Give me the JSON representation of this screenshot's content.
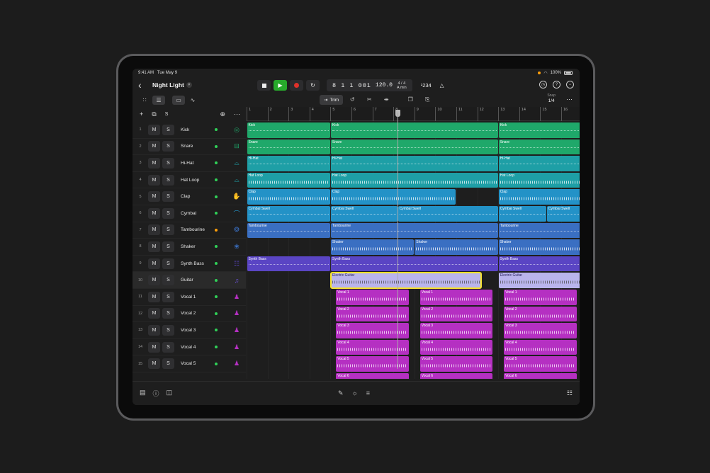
{
  "status": {
    "time": "9:41 AM",
    "date": "Tue May 9",
    "battery": "100%"
  },
  "project": {
    "title": "Night Light"
  },
  "transport": {
    "position": "8 1 1 001",
    "tempo": "120.0",
    "time_signature": "4 / 4",
    "key": "A min",
    "count_in": "¹234"
  },
  "toolbar": {
    "trim_label": "Trim",
    "snap_label": "Snap",
    "snap_value": "1/4"
  },
  "ruler": [
    "1",
    "2",
    "3",
    "4",
    "5",
    "6",
    "7",
    "8",
    "9",
    "10",
    "11",
    "12",
    "13",
    "14",
    "15",
    "16"
  ],
  "tracks": [
    {
      "num": "1",
      "name": "Kick",
      "icon": "kick-drum-icon",
      "color": "#1fa86a",
      "led": "green"
    },
    {
      "num": "2",
      "name": "Snare",
      "icon": "snare-drum-icon",
      "color": "#1fa86a",
      "led": "green"
    },
    {
      "num": "3",
      "name": "Hi-Hat",
      "icon": "hi-hat-icon",
      "color": "#1e9fa6",
      "led": "green"
    },
    {
      "num": "4",
      "name": "Hat Loop",
      "icon": "hi-hat-loop-icon",
      "color": "#1e9fa6",
      "led": "green"
    },
    {
      "num": "5",
      "name": "Clap",
      "icon": "clap-icon",
      "color": "#2392c7",
      "led": "green"
    },
    {
      "num": "6",
      "name": "Cymbal",
      "icon": "cymbal-icon",
      "color": "#2392c7",
      "led": "green"
    },
    {
      "num": "7",
      "name": "Tambourine",
      "icon": "tambourine-icon",
      "color": "#3a6fc2",
      "led": "orange"
    },
    {
      "num": "8",
      "name": "Shaker",
      "icon": "shaker-icon",
      "color": "#3a6fc2",
      "led": "green"
    },
    {
      "num": "9",
      "name": "Synth Bass",
      "icon": "keyboard-icon",
      "color": "#5a45c4",
      "led": "green"
    },
    {
      "num": "10",
      "name": "Guitar",
      "icon": "guitar-icon",
      "color": "#6a52d6",
      "led": "green"
    },
    {
      "num": "11",
      "name": "Vocal 1",
      "icon": "vocal-icon",
      "color": "#b530c2",
      "led": "green"
    },
    {
      "num": "12",
      "name": "Vocal 2",
      "icon": "vocal-icon",
      "color": "#b530c2",
      "led": "green"
    },
    {
      "num": "13",
      "name": "Vocal 3",
      "icon": "vocal-icon",
      "color": "#b530c2",
      "led": "green"
    },
    {
      "num": "14",
      "name": "Vocal 4",
      "icon": "vocal-icon",
      "color": "#b530c2",
      "led": "green"
    },
    {
      "num": "15",
      "name": "Vocal 5",
      "icon": "vocal-icon",
      "color": "#b530c2",
      "led": "green"
    }
  ],
  "mute_label": "M",
  "solo_label": "S",
  "regions": [
    {
      "lane": 0,
      "bar": 1,
      "len": 4,
      "label": "Kick",
      "kind": "midi"
    },
    {
      "lane": 0,
      "bar": 5,
      "len": 8,
      "label": "Kick",
      "kind": "midi"
    },
    {
      "lane": 0,
      "bar": 13,
      "len": 4,
      "label": "Kick",
      "kind": "midi"
    },
    {
      "lane": 1,
      "bar": 1,
      "len": 4,
      "label": "Snare",
      "kind": "midi"
    },
    {
      "lane": 1,
      "bar": 5,
      "len": 8,
      "label": "Snare",
      "kind": "midi"
    },
    {
      "lane": 1,
      "bar": 13,
      "len": 4,
      "label": "Snare",
      "kind": "midi"
    },
    {
      "lane": 2,
      "bar": 1,
      "len": 4,
      "label": "Hi-Hat",
      "kind": "midi"
    },
    {
      "lane": 2,
      "bar": 5,
      "len": 8,
      "label": "Hi-Hat",
      "kind": "midi"
    },
    {
      "lane": 2,
      "bar": 13,
      "len": 4,
      "label": "Hi-Hat",
      "kind": "midi"
    },
    {
      "lane": 3,
      "bar": 1,
      "len": 4,
      "label": "Hat Loop",
      "kind": "audio"
    },
    {
      "lane": 3,
      "bar": 5,
      "len": 8,
      "label": "Hat Loop",
      "kind": "audio"
    },
    {
      "lane": 3,
      "bar": 13,
      "len": 4,
      "label": "Hat Loop",
      "kind": "audio"
    },
    {
      "lane": 4,
      "bar": 1,
      "len": 4,
      "label": "Clap",
      "kind": "audio"
    },
    {
      "lane": 4,
      "bar": 5,
      "len": 6,
      "label": "Clap",
      "kind": "audio"
    },
    {
      "lane": 4,
      "bar": 13,
      "len": 4,
      "label": "Clap",
      "kind": "audio"
    },
    {
      "lane": 5,
      "bar": 1,
      "len": 4,
      "label": "Cymbal Swell",
      "kind": "midi"
    },
    {
      "lane": 5,
      "bar": 5,
      "len": 3.2,
      "label": "Cymbal Swell",
      "kind": "midi"
    },
    {
      "lane": 5,
      "bar": 8.2,
      "len": 4.8,
      "label": "Cymbal Swell",
      "kind": "midi"
    },
    {
      "lane": 5,
      "bar": 13,
      "len": 2.3,
      "label": "Cymbal Swell",
      "kind": "midi"
    },
    {
      "lane": 5,
      "bar": 15.3,
      "len": 1.7,
      "label": "Cymbal Swell",
      "kind": "midi"
    },
    {
      "lane": 6,
      "bar": 1,
      "len": 4,
      "label": "Tambourine",
      "kind": "midi"
    },
    {
      "lane": 6,
      "bar": 5,
      "len": 8,
      "label": "Tambourine",
      "kind": "midi"
    },
    {
      "lane": 6,
      "bar": 13,
      "len": 4,
      "label": "Tambourine",
      "kind": "midi"
    },
    {
      "lane": 7,
      "bar": 5,
      "len": 4,
      "label": "Shaker",
      "kind": "audio"
    },
    {
      "lane": 7,
      "bar": 9,
      "len": 4,
      "label": "Shaker",
      "kind": "audio"
    },
    {
      "lane": 7,
      "bar": 13,
      "len": 4,
      "label": "Shaker",
      "kind": "audio"
    },
    {
      "lane": 8,
      "bar": 1,
      "len": 4,
      "label": "Synth Bass",
      "kind": "midi"
    },
    {
      "lane": 8,
      "bar": 5,
      "len": 8,
      "label": "Synth Bass",
      "kind": "midi"
    },
    {
      "lane": 8,
      "bar": 13,
      "len": 4,
      "label": "Synth Bass",
      "kind": "midi"
    },
    {
      "lane": 9,
      "bar": 5,
      "len": 7.2,
      "label": "Electric Guitar",
      "kind": "audio",
      "selected": true
    },
    {
      "lane": 9,
      "bar": 13,
      "len": 4,
      "label": "Electric Guitar",
      "kind": "audio"
    },
    {
      "lane": 10,
      "bar": 5.25,
      "len": 3.5,
      "label": "Vocal 1",
      "kind": "audio"
    },
    {
      "lane": 10,
      "bar": 9.25,
      "len": 3.5,
      "label": "Vocal 1",
      "kind": "audio"
    },
    {
      "lane": 10,
      "bar": 13.25,
      "len": 3.5,
      "label": "Vocal 1",
      "kind": "audio"
    },
    {
      "lane": 11,
      "bar": 5.25,
      "len": 3.5,
      "label": "Vocal 2",
      "kind": "audio"
    },
    {
      "lane": 11,
      "bar": 9.25,
      "len": 3.5,
      "label": "Vocal 2",
      "kind": "audio"
    },
    {
      "lane": 11,
      "bar": 13.25,
      "len": 3.5,
      "label": "Vocal 2",
      "kind": "audio"
    },
    {
      "lane": 12,
      "bar": 5.25,
      "len": 3.5,
      "label": "Vocal 3",
      "kind": "audio"
    },
    {
      "lane": 12,
      "bar": 9.25,
      "len": 3.5,
      "label": "Vocal 3",
      "kind": "audio"
    },
    {
      "lane": 12,
      "bar": 13.25,
      "len": 3.5,
      "label": "Vocal 3",
      "kind": "audio"
    },
    {
      "lane": 13,
      "bar": 5.25,
      "len": 3.5,
      "label": "Vocal 4",
      "kind": "audio"
    },
    {
      "lane": 13,
      "bar": 9.25,
      "len": 3.5,
      "label": "Vocal 4",
      "kind": "audio"
    },
    {
      "lane": 13,
      "bar": 13.25,
      "len": 3.5,
      "label": "Vocal 4",
      "kind": "audio"
    },
    {
      "lane": 14,
      "bar": 5.25,
      "len": 3.5,
      "label": "Vocal 5",
      "kind": "audio"
    },
    {
      "lane": 14,
      "bar": 9.25,
      "len": 3.5,
      "label": "Vocal 5",
      "kind": "audio"
    },
    {
      "lane": 14,
      "bar": 13.25,
      "len": 3.5,
      "label": "Vocal 5",
      "kind": "audio"
    },
    {
      "lane": 15,
      "bar": 5.25,
      "len": 3.5,
      "label": "Vocal 6",
      "kind": "audio"
    },
    {
      "lane": 15,
      "bar": 9.25,
      "len": 3.5,
      "label": "Vocal 6",
      "kind": "audio"
    },
    {
      "lane": 15,
      "bar": 13.25,
      "len": 3.5,
      "label": "Vocal 6",
      "kind": "audio"
    }
  ],
  "playhead_bar": 8.0
}
